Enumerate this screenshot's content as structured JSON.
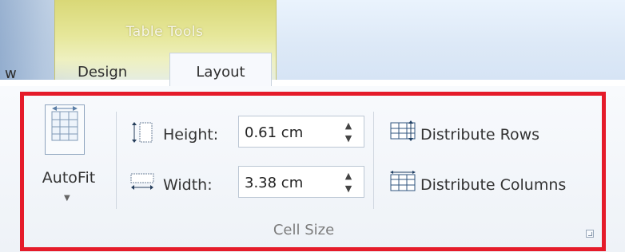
{
  "header": {
    "table_tools": "Table Tools"
  },
  "tabs": {
    "partial": "w",
    "design": "Design",
    "layout": "Layout"
  },
  "cell_size": {
    "autofit_label": "AutoFit",
    "height_label": "Height:",
    "height_value": "0.61 cm",
    "width_label": "Width:",
    "width_value": "3.38 cm",
    "distribute_rows": "Distribute Rows",
    "distribute_columns": "Distribute Columns",
    "group_label": "Cell Size"
  },
  "icons": {
    "autofit": "autofit-icon",
    "row_height": "row-height-icon",
    "column_width": "column-width-icon",
    "spin_up": "spin-up-icon",
    "spin_down": "spin-down-icon",
    "distribute_rows": "distribute-rows-icon",
    "distribute_columns": "distribute-columns-icon",
    "dialog_launcher": "dialog-launcher-icon"
  },
  "colors": {
    "highlight_border": "#e51b2a",
    "table_tools_band": "#e6e79a",
    "ribbon_background": "#f3f6fa"
  }
}
